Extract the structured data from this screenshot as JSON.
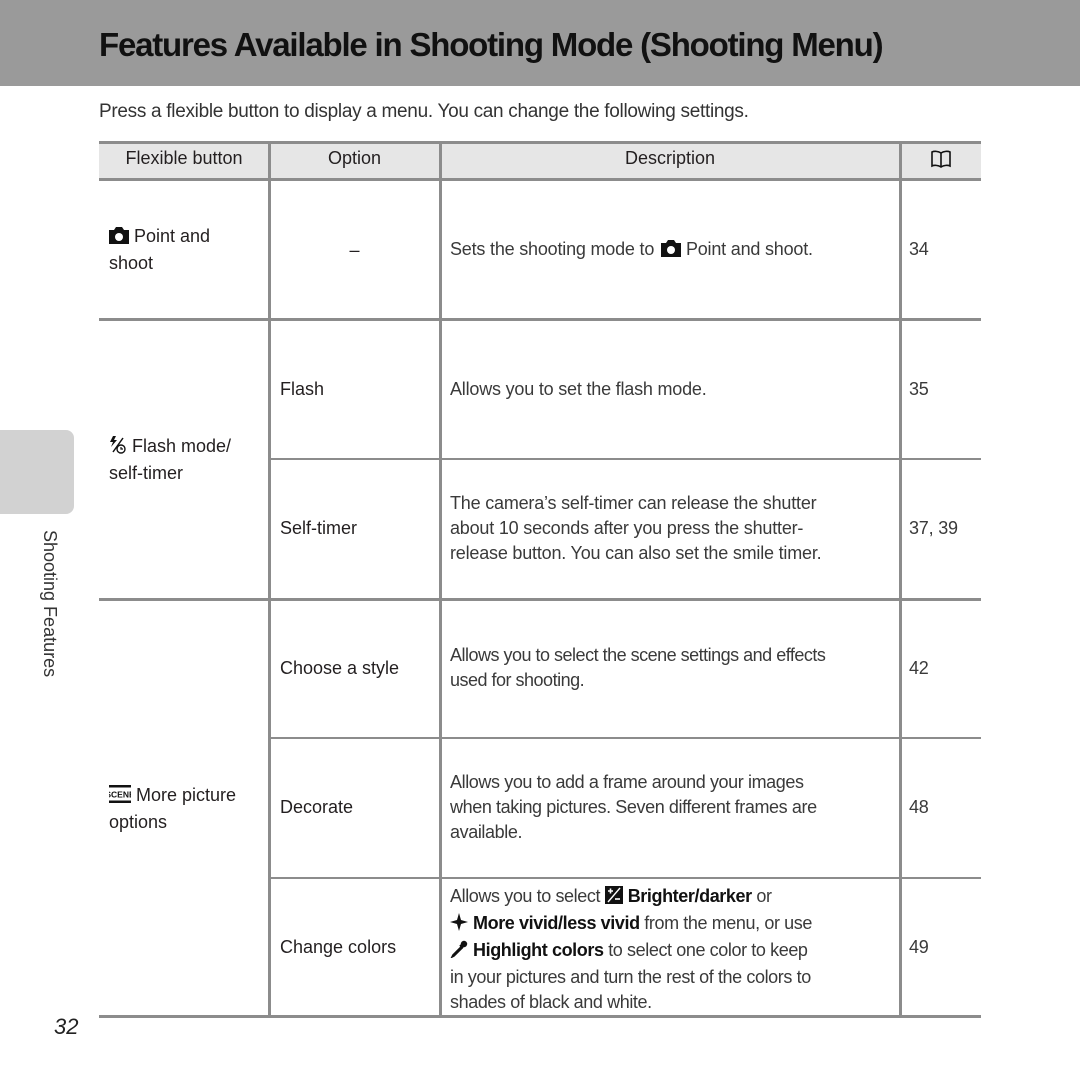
{
  "page": {
    "title": "Features Available in Shooting Mode (Shooting Menu)",
    "intro": "Press a flexible button to display a menu. You can change the following settings.",
    "side_tab_label": "Shooting Features",
    "page_number": "32"
  },
  "table": {
    "headers": {
      "flexible_button": "Flexible button",
      "option": "Option",
      "description": "Description",
      "reference_icon": "book-icon"
    },
    "groups": [
      {
        "button_icon": "camera-icon",
        "button_label": "Point and shoot",
        "button_label_lines": [
          "Point and",
          "shoot"
        ],
        "rows": [
          {
            "option": "–",
            "description_parts": [
              "Sets the shooting mode to ",
              "Point and shoot."
            ],
            "description_icon": "camera-icon",
            "pages": "34"
          }
        ]
      },
      {
        "button_icon": "flash-self-timer-icon",
        "button_label_lines": [
          "Flash mode/",
          "self-timer"
        ],
        "rows": [
          {
            "option": "Flash",
            "description": "Allows you to set the flash mode.",
            "pages": "35"
          },
          {
            "option": "Self-timer",
            "description_lines": [
              "The camera’s self-timer can release the shutter",
              "about 10 seconds after you press the shutter-",
              "release button. You can also set the smile timer."
            ],
            "pages": "37, 39"
          }
        ]
      },
      {
        "button_icon": "scene-icon",
        "button_label_lines": [
          "More picture",
          "options"
        ],
        "rows": [
          {
            "option": "Choose a style",
            "description_lines": [
              "Allows you to select the scene settings and effects",
              "used for shooting."
            ],
            "pages": "42"
          },
          {
            "option": "Decorate",
            "description_lines": [
              "Allows you to add a frame around your images",
              "when taking pictures. Seven different frames are",
              "available."
            ],
            "pages": "48"
          },
          {
            "option": "Change colors",
            "description_rich": {
              "l1_pre": "Allows you to select ",
              "l1_icon": "brightness-icon",
              "l1_bold": "Brighter/darker",
              "l1_post": " or",
              "l2_icon": "vivid-icon",
              "l2_bold": "More vivid/less vivid",
              "l2_post": " from the menu, or use",
              "l3_icon": "eyedropper-icon",
              "l3_bold": "Highlight colors",
              "l3_post": " to select one color to keep",
              "l4": "in your pictures and turn the rest of the colors to",
              "l5": "shades of black and white."
            },
            "pages": "49"
          }
        ]
      }
    ]
  }
}
